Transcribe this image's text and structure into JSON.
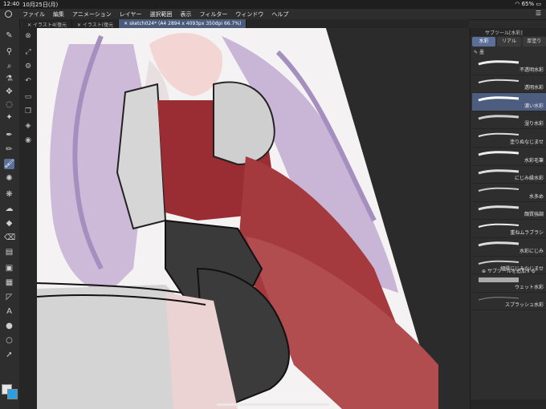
{
  "status": {
    "time": "12:40",
    "date": "10月25日(月)",
    "battery": "65%"
  },
  "menu": {
    "items": [
      "ファイル",
      "編集",
      "アニメーション",
      "レイヤー",
      "選択範囲",
      "表示",
      "フィルター",
      "ウィンドウ",
      "ヘルプ"
    ],
    "menu_button": "☰"
  },
  "tabs": [
    {
      "label": "イラスト4(復元"
    },
    {
      "label": "イラスト(復元"
    },
    {
      "label": "sketch024* (A4 2894 x 4093px 350dpi 66.7%)"
    }
  ],
  "panel": {
    "title": "サブツール[水彩]",
    "subtabs": [
      "水彩",
      "リアル",
      "厚塗り"
    ],
    "group": "墨",
    "brushes": [
      {
        "name": "不透明水彩"
      },
      {
        "name": "透明水彩"
      },
      {
        "name": "濃い水彩"
      },
      {
        "name": "湿り水彩"
      },
      {
        "name": "塗りぬなじませ"
      },
      {
        "name": "水彩毛筆"
      },
      {
        "name": "にじみ縁水彩"
      },
      {
        "name": "水多め"
      },
      {
        "name": "顔質強調"
      },
      {
        "name": "重ねムラブラシ"
      },
      {
        "name": "水彩にじみ"
      },
      {
        "name": "細縁にじみなじませ"
      },
      {
        "name": "ウェット水彩"
      },
      {
        "name": "スプラッシュ水彩"
      }
    ],
    "add_subtool": "サブツールを追加する"
  },
  "colors": {
    "main": "#e6e6e6",
    "sub": "#2aa0e0",
    "accent": "#5b6f9a"
  }
}
